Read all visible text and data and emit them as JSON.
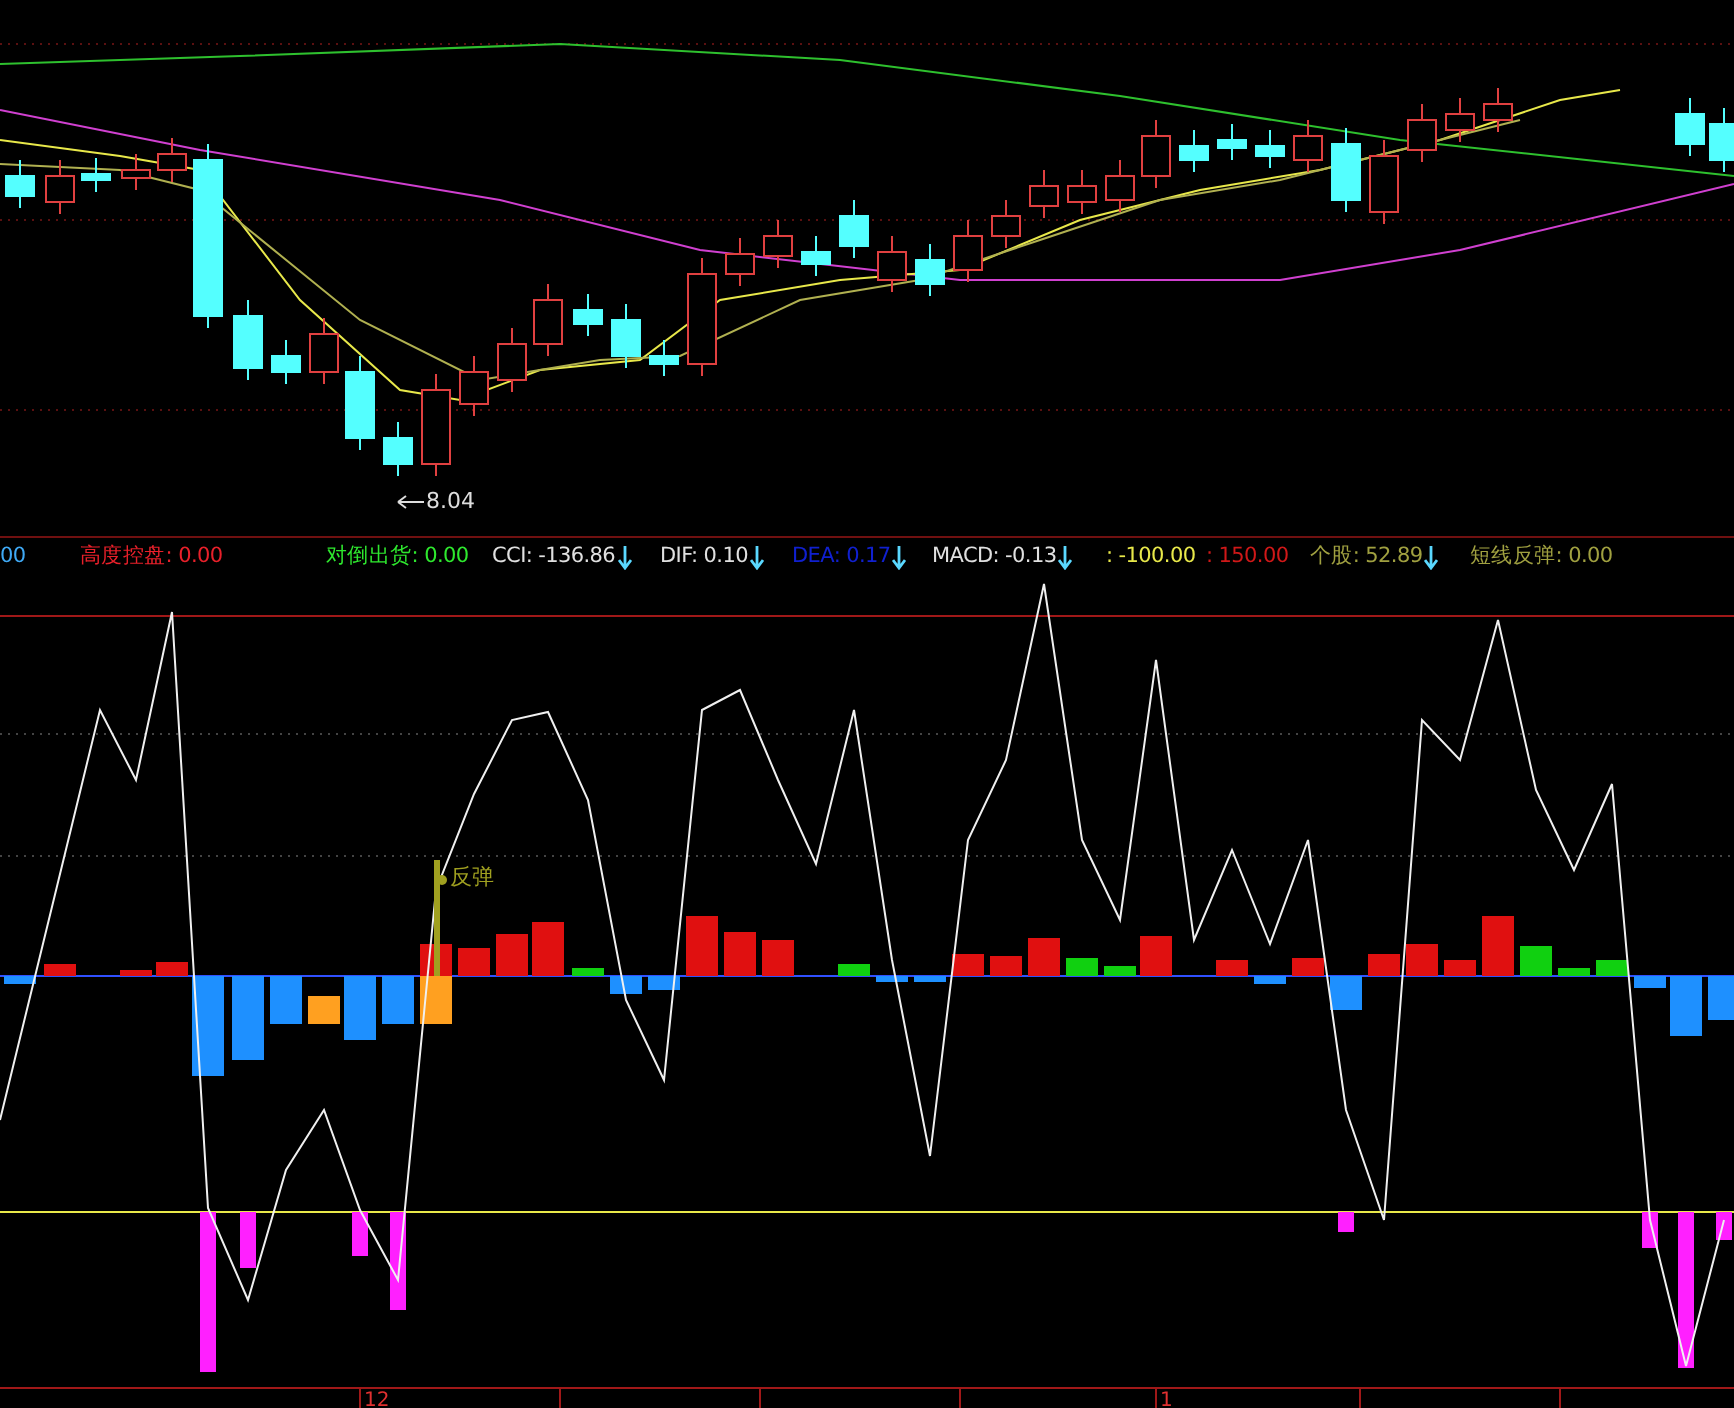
{
  "price_chart": {
    "low_label": "8.04"
  },
  "indicator_legend": [
    {
      "text": "00",
      "color": "#3fa9f5",
      "down_arrow": false
    },
    {
      "text": "高度控盘: 0.00",
      "color": "#e8202a",
      "down_arrow": false
    },
    {
      "text": "对倒出货: 0.00",
      "color": "#2ee82e",
      "down_arrow": false
    },
    {
      "text": "CCI: -136.86",
      "color": "#e0e0e0",
      "down_arrow": true
    },
    {
      "text": "DIF: 0.10",
      "color": "#e0e0e0",
      "down_arrow": true
    },
    {
      "text": "DEA: 0.17",
      "color": "#1020d0",
      "down_arrow": true
    },
    {
      "text": "MACD: -0.13",
      "color": "#e0e0e0",
      "down_arrow": true
    },
    {
      "text": ": -100.00",
      "color": "#e8e84a",
      "down_arrow": false
    },
    {
      "text": ": 150.00",
      "color": "#d01818",
      "down_arrow": false
    },
    {
      "text": "个股: 52.89",
      "color": "#a0a040",
      "down_arrow": true
    },
    {
      "text": "短线反弹: 0.00",
      "color": "#a0a040",
      "down_arrow": false
    }
  ],
  "indicator_chart": {
    "signal_label": "反弹"
  },
  "time_axis": {
    "labels": [
      "12",
      "1"
    ]
  }
}
